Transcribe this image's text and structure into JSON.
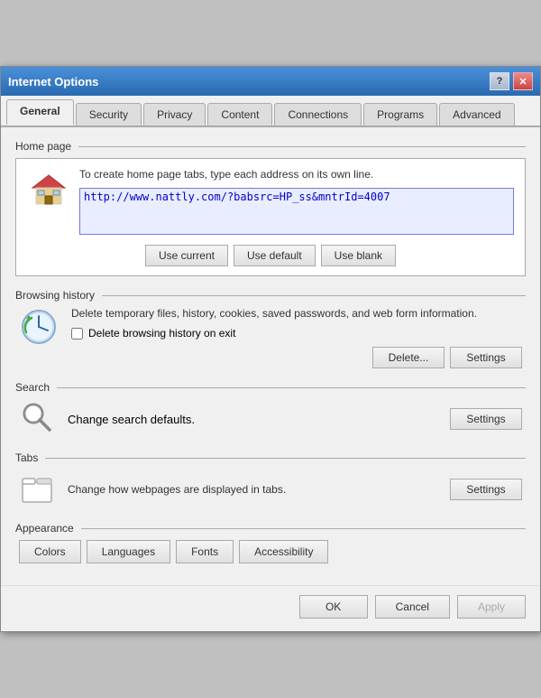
{
  "window": {
    "title": "Internet Options",
    "help_btn": "?",
    "close_btn": "✕"
  },
  "tabs": [
    {
      "label": "General",
      "active": true
    },
    {
      "label": "Security",
      "active": false
    },
    {
      "label": "Privacy",
      "active": false
    },
    {
      "label": "Content",
      "active": false
    },
    {
      "label": "Connections",
      "active": false
    },
    {
      "label": "Programs",
      "active": false
    },
    {
      "label": "Advanced",
      "active": false
    }
  ],
  "home_page": {
    "section_label": "Home page",
    "description": "To create home page tabs, type each address on its own line.",
    "url_value": "http://www.nattly.com/?babsrc=HP_ss&mntrId=4007",
    "btn_use_current": "Use current",
    "btn_use_default": "Use default",
    "btn_use_blank": "Use blank"
  },
  "browsing_history": {
    "section_label": "Browsing history",
    "description": "Delete temporary files, history, cookies, saved passwords, and web form information.",
    "checkbox_label": "Delete browsing history on exit",
    "checkbox_checked": false,
    "btn_delete": "Delete...",
    "btn_settings": "Settings"
  },
  "search": {
    "section_label": "Search",
    "description": "Change search defaults.",
    "btn_settings": "Settings"
  },
  "tabs_section": {
    "section_label": "Tabs",
    "description": "Change how webpages are displayed in tabs.",
    "btn_settings": "Settings"
  },
  "appearance": {
    "section_label": "Appearance",
    "btn_colors": "Colors",
    "btn_languages": "Languages",
    "btn_fonts": "Fonts",
    "btn_accessibility": "Accessibility"
  },
  "bottom_bar": {
    "btn_ok": "OK",
    "btn_cancel": "Cancel",
    "btn_apply": "Apply"
  },
  "colors": {
    "title_bar_start": "#4a90d9",
    "title_bar_end": "#2a6ab0",
    "accent": "#0000cc",
    "url_bg": "#e8eeff"
  }
}
